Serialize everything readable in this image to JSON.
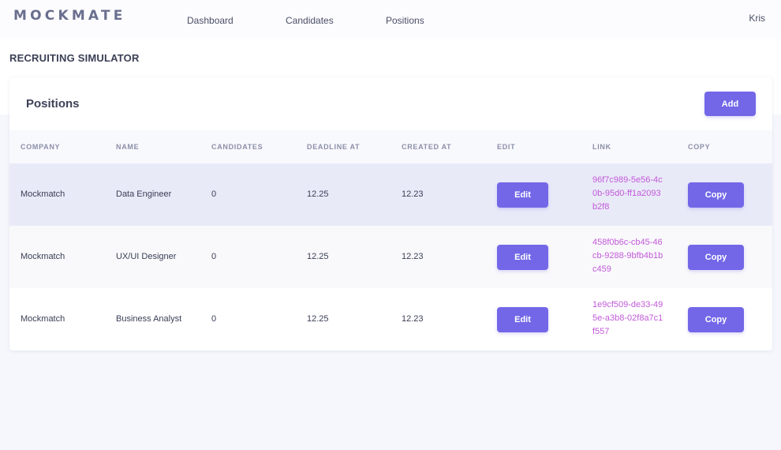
{
  "app": {
    "brand": "MOCKMATE",
    "user": "Kris"
  },
  "nav": {
    "items": [
      "Dashboard",
      "Candidates",
      "Positions"
    ]
  },
  "page": {
    "title": "RECRUITING SIMULATOR"
  },
  "card": {
    "title": "Positions",
    "add_label": "Add"
  },
  "table": {
    "headers": [
      "COMPANY",
      "NAME",
      "CANDIDATES",
      "DEADLINE AT",
      "CREATED AT",
      "EDIT",
      "LINK",
      "COPY"
    ],
    "edit_label": "Edit",
    "copy_label": "Copy",
    "rows": [
      {
        "company": "Mockmatch",
        "name": "Data Engineer",
        "candidates": "0",
        "deadline": "12.25",
        "created": "12.23",
        "link": "96f7c989-5e56-4c0b-95d0-ff1a2093b2f8"
      },
      {
        "company": "Mockmatch",
        "name": "UX/UI Designer",
        "candidates": "0",
        "deadline": "12.25",
        "created": "12.23",
        "link": "458f0b6c-cb45-46cb-9288-9bfb4b1bc459"
      },
      {
        "company": "Mockmatch",
        "name": "Business Analyst",
        "candidates": "0",
        "deadline": "12.25",
        "created": "12.23",
        "link": "1e9cf509-de33-495e-a3b8-02f8a7c1f557"
      }
    ]
  },
  "colors": {
    "accent": "#7367e8",
    "link": "#c25ad9",
    "row_highlight": "#e9eaf8",
    "row_alt": "#f9f9fb",
    "row_plain": "#ffffff"
  }
}
